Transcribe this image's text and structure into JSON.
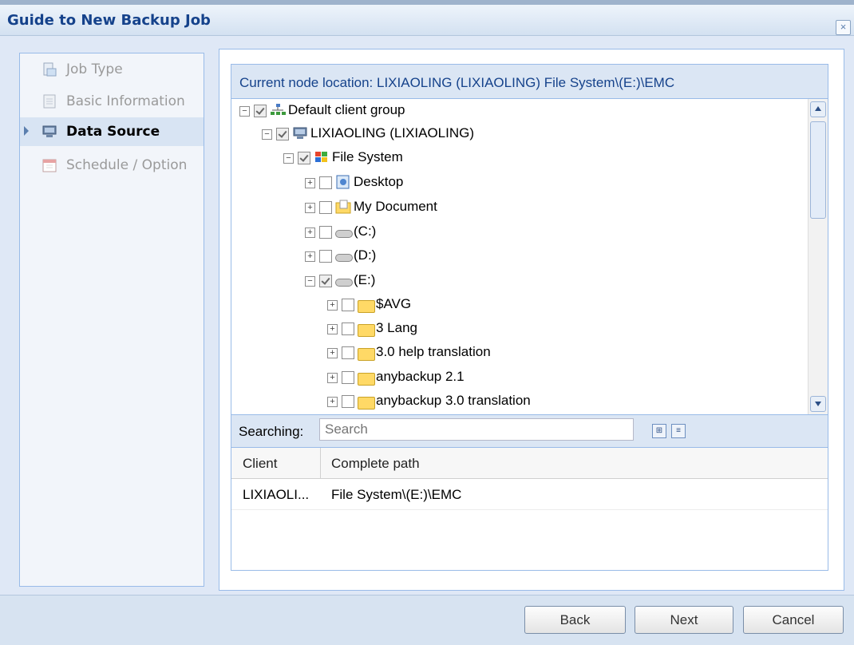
{
  "dialog": {
    "title": "Guide to New Backup Job",
    "close_glyph": "×"
  },
  "sidebar": {
    "items": [
      {
        "label": "Job Type",
        "icon": "job-type-icon",
        "active": false
      },
      {
        "label": "Basic Information",
        "icon": "document-icon",
        "active": false
      },
      {
        "label": "Data Source",
        "icon": "computer-icon",
        "active": true
      },
      {
        "label": "Schedule / Option",
        "icon": "calendar-icon",
        "active": false
      }
    ]
  },
  "panel": {
    "header": "Current node location: LIXIAOLING (LIXIAOLING) File System\\(E:)\\EMC"
  },
  "tree": {
    "nodes": [
      {
        "label": "Default client group",
        "checked": true,
        "expanded": true,
        "icon": "network-group-icon"
      },
      {
        "label": "LIXIAOLING (LIXIAOLING)",
        "checked": true,
        "expanded": true,
        "icon": "computer-icon"
      },
      {
        "label": "File System",
        "checked": true,
        "expanded": true,
        "icon": "windows-logo-icon"
      },
      {
        "label": "Desktop",
        "checked": false,
        "expanded": false,
        "icon": "desktop-icon"
      },
      {
        "label": "My Document",
        "checked": false,
        "expanded": false,
        "icon": "my-documents-icon"
      },
      {
        "label": "(C:)",
        "checked": false,
        "expanded": false,
        "icon": "drive-icon"
      },
      {
        "label": "(D:)",
        "checked": false,
        "expanded": false,
        "icon": "drive-icon"
      },
      {
        "label": "(E:)",
        "checked": true,
        "expanded": true,
        "icon": "drive-icon"
      },
      {
        "label": "$AVG",
        "checked": false,
        "expanded": false,
        "icon": "folder-icon"
      },
      {
        "label": "3 Lang",
        "checked": false,
        "expanded": false,
        "icon": "folder-icon"
      },
      {
        "label": "3.0 help translation",
        "checked": false,
        "expanded": false,
        "icon": "folder-icon"
      },
      {
        "label": "anybackup 2.1",
        "checked": false,
        "expanded": false,
        "icon": "folder-icon"
      },
      {
        "label": "anybackup 3.0 translation",
        "checked": false,
        "expanded": false,
        "icon": "folder-icon"
      }
    ]
  },
  "search": {
    "label": "Searching:",
    "placeholder": "Search"
  },
  "grid": {
    "columns": [
      "Client",
      "Complete path"
    ],
    "rows": [
      {
        "client": "LIXIAOLI...",
        "path": "File System\\(E:)\\EMC"
      }
    ]
  },
  "buttons": {
    "back": "Back",
    "next": "Next",
    "cancel": "Cancel"
  }
}
